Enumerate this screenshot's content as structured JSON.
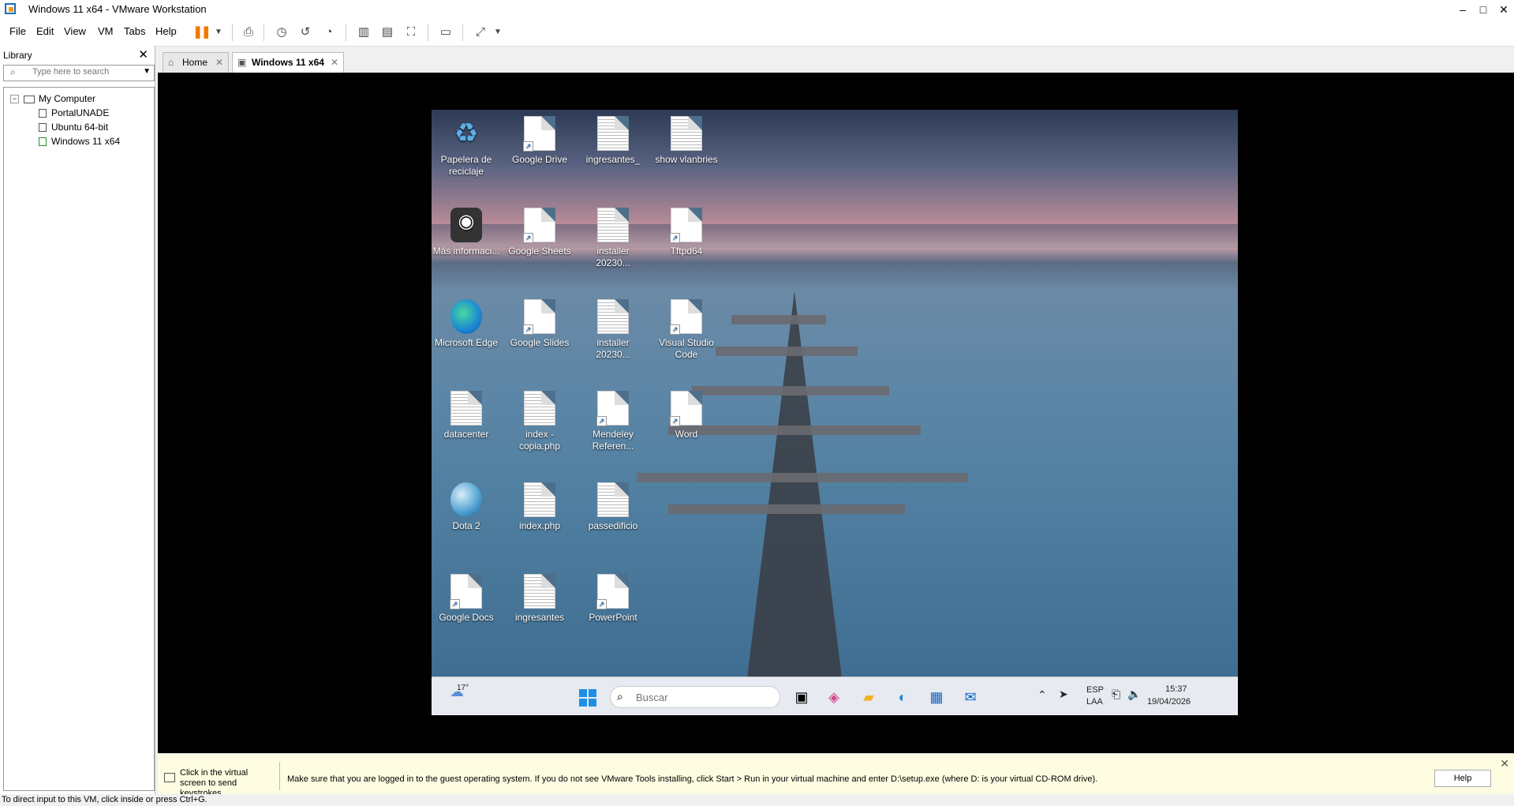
{
  "window": {
    "title": "Windows 11 x64 - VMware Workstation",
    "minimize": "–",
    "maximize": "□",
    "close": "✕"
  },
  "menu": [
    "File",
    "Edit",
    "View",
    "VM",
    "Tabs",
    "Help"
  ],
  "toolbar": {
    "pause_icon": "pause-icon",
    "send_keys_icon": "send-keys-icon",
    "snapshot_icon": "snapshot-icon",
    "revert_icon": "revert-icon",
    "manage_snapshots_icon": "manage-snapshots-icon",
    "library_icon": "library-view-icon",
    "thumb_icon": "thumbnail-view-icon",
    "fullscreen_icon": "fullscreen-icon",
    "console_icon": "console-icon",
    "stretch_icon": "stretch-icon"
  },
  "library": {
    "header": "Library",
    "close": "✕",
    "search_placeholder": "Type here to search",
    "root": "My Computer",
    "vms": [
      "PortalUNADE",
      "Ubuntu 64-bit",
      "Windows 11 x64"
    ]
  },
  "tabs": [
    {
      "label": "Home",
      "close": "✕"
    },
    {
      "label": "Windows 11 x64",
      "close": "✕"
    }
  ],
  "desktop": {
    "icons": [
      {
        "label": "Papelera de reciclaje",
        "kind": "recycle-bin-icon"
      },
      {
        "label": "Google Drive",
        "kind": "shortcut-file-icon"
      },
      {
        "label": "ingresantes_",
        "kind": "text-file-icon"
      },
      {
        "label": "show vlanbries",
        "kind": "text-file-icon"
      },
      {
        "label": "Más informaci...",
        "kind": "info-app-icon"
      },
      {
        "label": "Google Sheets",
        "kind": "shortcut-file-icon"
      },
      {
        "label": "installer 20230...",
        "kind": "text-file-icon"
      },
      {
        "label": "Tftpd64",
        "kind": "shortcut-file-icon"
      },
      {
        "label": "Microsoft Edge",
        "kind": "edge-icon"
      },
      {
        "label": "Google Slides",
        "kind": "shortcut-file-icon"
      },
      {
        "label": "installer 20230...",
        "kind": "text-file-icon"
      },
      {
        "label": "Visual Studio Code",
        "kind": "shortcut-file-icon"
      },
      {
        "label": "datacenter",
        "kind": "text-file-icon"
      },
      {
        "label": "index - copia.php",
        "kind": "text-file-icon"
      },
      {
        "label": "Mendeley Referen...",
        "kind": "shortcut-file-icon"
      },
      {
        "label": "Word",
        "kind": "shortcut-file-icon"
      },
      {
        "label": "Dota 2",
        "kind": "globe-icon"
      },
      {
        "label": "index.php",
        "kind": "text-file-icon"
      },
      {
        "label": "passedificio",
        "kind": "text-file-icon"
      },
      {
        "label": "Google Docs",
        "kind": "shortcut-file-icon"
      },
      {
        "label": "ingresantes",
        "kind": "text-file-icon"
      },
      {
        "label": "PowerPoint",
        "kind": "shortcut-file-icon"
      }
    ]
  },
  "taskbar": {
    "weather": "17°",
    "search_placeholder": "Buscar",
    "language": "ESP",
    "layout": "LAA",
    "time": "15:37",
    "date": "19/04/2026"
  },
  "infobar": {
    "hint": "Click in the virtual screen to send keystrokes",
    "message": "Make sure that you are logged in to the guest operating system. If you do not see VMware Tools installing, click Start > Run in your virtual machine and enter D:\\setup.exe (where D: is your virtual CD-ROM drive).",
    "help": "Help",
    "close": "✕"
  },
  "status": {
    "text": "To direct input to this VM, click inside or press Ctrl+G."
  }
}
